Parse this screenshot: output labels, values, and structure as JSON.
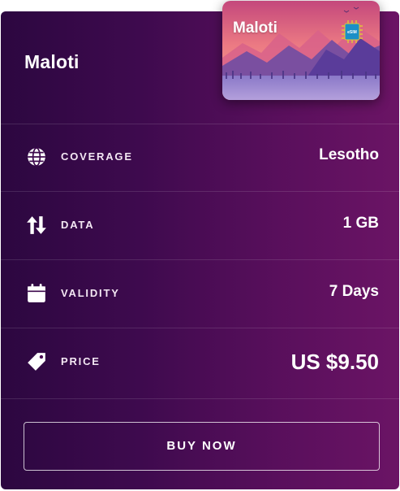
{
  "plan": {
    "name": "Maloti"
  },
  "sim_card": {
    "name": "Maloti",
    "chip_label": "eSIM"
  },
  "details": {
    "coverage": {
      "label": "COVERAGE",
      "value": "Lesotho",
      "icon": "globe-icon"
    },
    "data": {
      "label": "DATA",
      "value": "1 GB",
      "icon": "up-down-arrows-icon"
    },
    "validity": {
      "label": "VALIDITY",
      "value": "7 Days",
      "icon": "calendar-icon"
    },
    "price": {
      "label": "PRICE",
      "value": "US $9.50",
      "icon": "price-tag-icon"
    }
  },
  "actions": {
    "buy_label": "BUY NOW"
  },
  "colors": {
    "card_gradient_start": "#2c0740",
    "card_gradient_end": "#6b1465",
    "text": "#ffffff"
  }
}
